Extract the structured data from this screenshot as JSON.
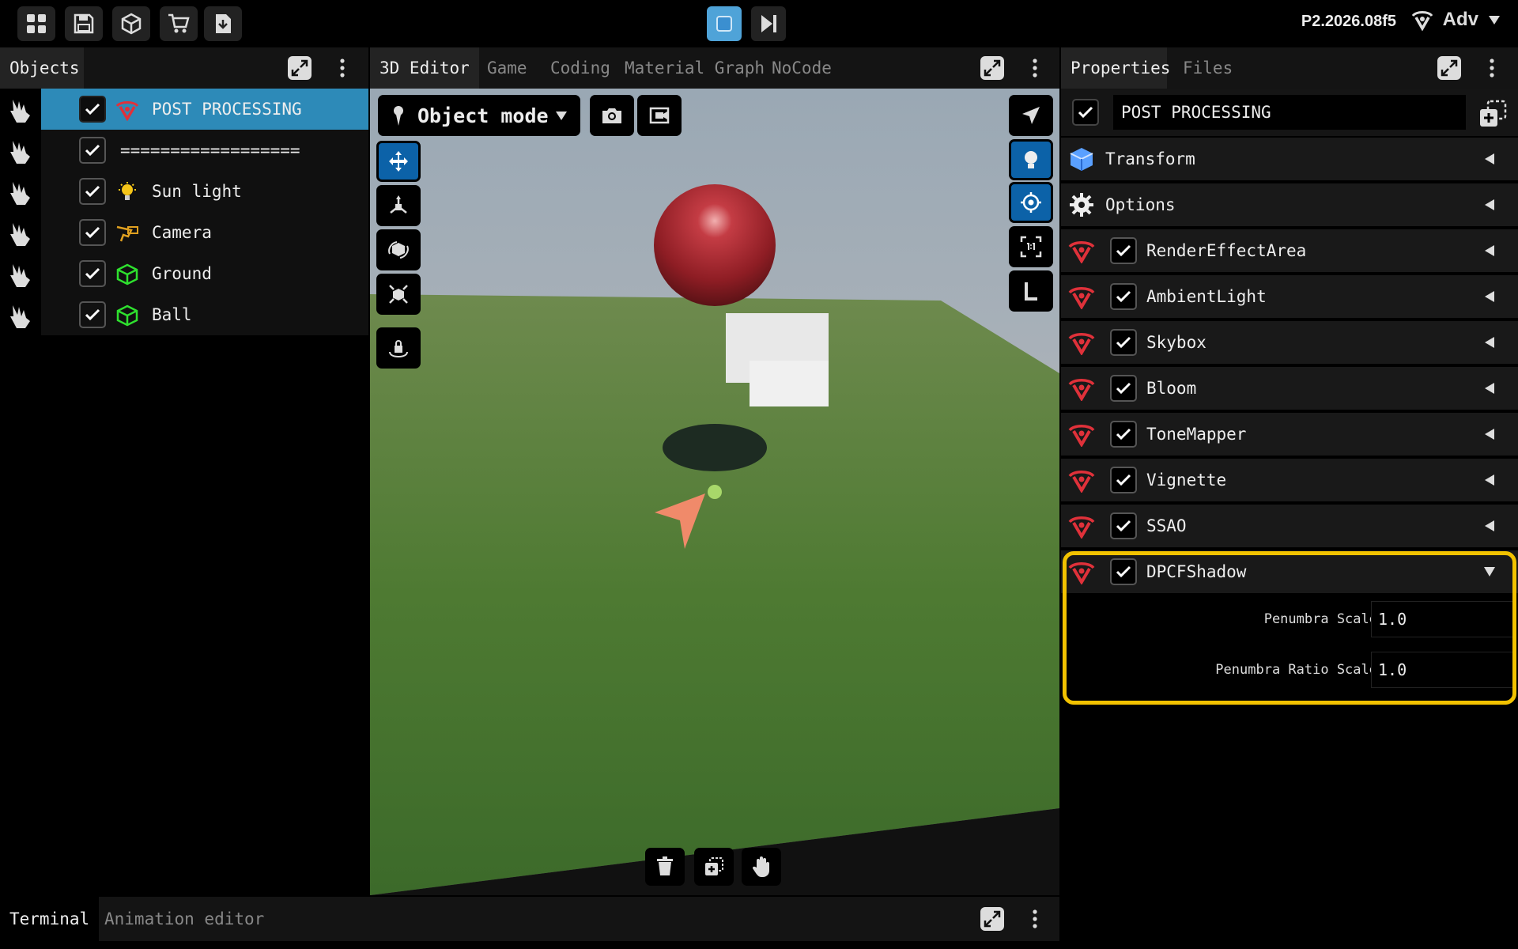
{
  "topbar": {
    "version": "P2.2026.08f5",
    "user_label": "Adv",
    "colors": {
      "play_active": "#4fa3d8"
    }
  },
  "objects_panel": {
    "tab_label": "Objects",
    "items": [
      {
        "label": "POST PROCESSING",
        "icon": "post-processing-icon",
        "selected": true
      },
      {
        "label": "==================",
        "icon": "",
        "selected": false
      },
      {
        "label": "Sun light",
        "icon": "light-bulb-icon",
        "selected": false
      },
      {
        "label": "Camera",
        "icon": "camera-icon",
        "selected": false
      },
      {
        "label": "Ground",
        "icon": "mesh-icon",
        "selected": false
      },
      {
        "label": "Ball",
        "icon": "mesh-icon",
        "selected": false
      }
    ]
  },
  "editor": {
    "tabs": [
      {
        "label": "3D Editor",
        "active": true
      },
      {
        "label": "Game",
        "active": false
      },
      {
        "label": "Coding",
        "active": false
      },
      {
        "label": "Material Graph",
        "active": false
      },
      {
        "label": "NoCode",
        "active": false
      }
    ],
    "mode_label": "Object mode"
  },
  "properties": {
    "tabs": [
      {
        "label": "Properties",
        "active": true
      },
      {
        "label": "Files",
        "active": false
      }
    ],
    "object_name": "POST PROCESSING",
    "sections": [
      {
        "label": "Transform",
        "icon": "cube-icon",
        "checkbox": false,
        "expanded": false
      },
      {
        "label": "Options",
        "icon": "gear-icon",
        "checkbox": false,
        "expanded": false
      },
      {
        "label": "RenderEffectArea",
        "icon": "post-processing-icon",
        "checkbox": true,
        "expanded": false
      },
      {
        "label": "AmbientLight",
        "icon": "post-processing-icon",
        "checkbox": true,
        "expanded": false
      },
      {
        "label": "Skybox",
        "icon": "post-processing-icon",
        "checkbox": true,
        "expanded": false
      },
      {
        "label": "Bloom",
        "icon": "post-processing-icon",
        "checkbox": true,
        "expanded": false
      },
      {
        "label": "ToneMapper",
        "icon": "post-processing-icon",
        "checkbox": true,
        "expanded": false
      },
      {
        "label": "Vignette",
        "icon": "post-processing-icon",
        "checkbox": true,
        "expanded": false
      },
      {
        "label": "SSAO",
        "icon": "post-processing-icon",
        "checkbox": true,
        "expanded": false
      },
      {
        "label": "DPCFShadow",
        "icon": "post-processing-icon",
        "checkbox": true,
        "expanded": true
      }
    ],
    "dpcf_fields": [
      {
        "label": "Penumbra Scale",
        "value": "1.0"
      },
      {
        "label": "Penumbra Ratio Scale",
        "value": "1.0"
      }
    ],
    "highlight_color": "#f2c200"
  },
  "bottom_panel": {
    "tabs": [
      {
        "label": "Terminal",
        "active": true
      },
      {
        "label": "Animation editor",
        "active": false
      }
    ]
  }
}
